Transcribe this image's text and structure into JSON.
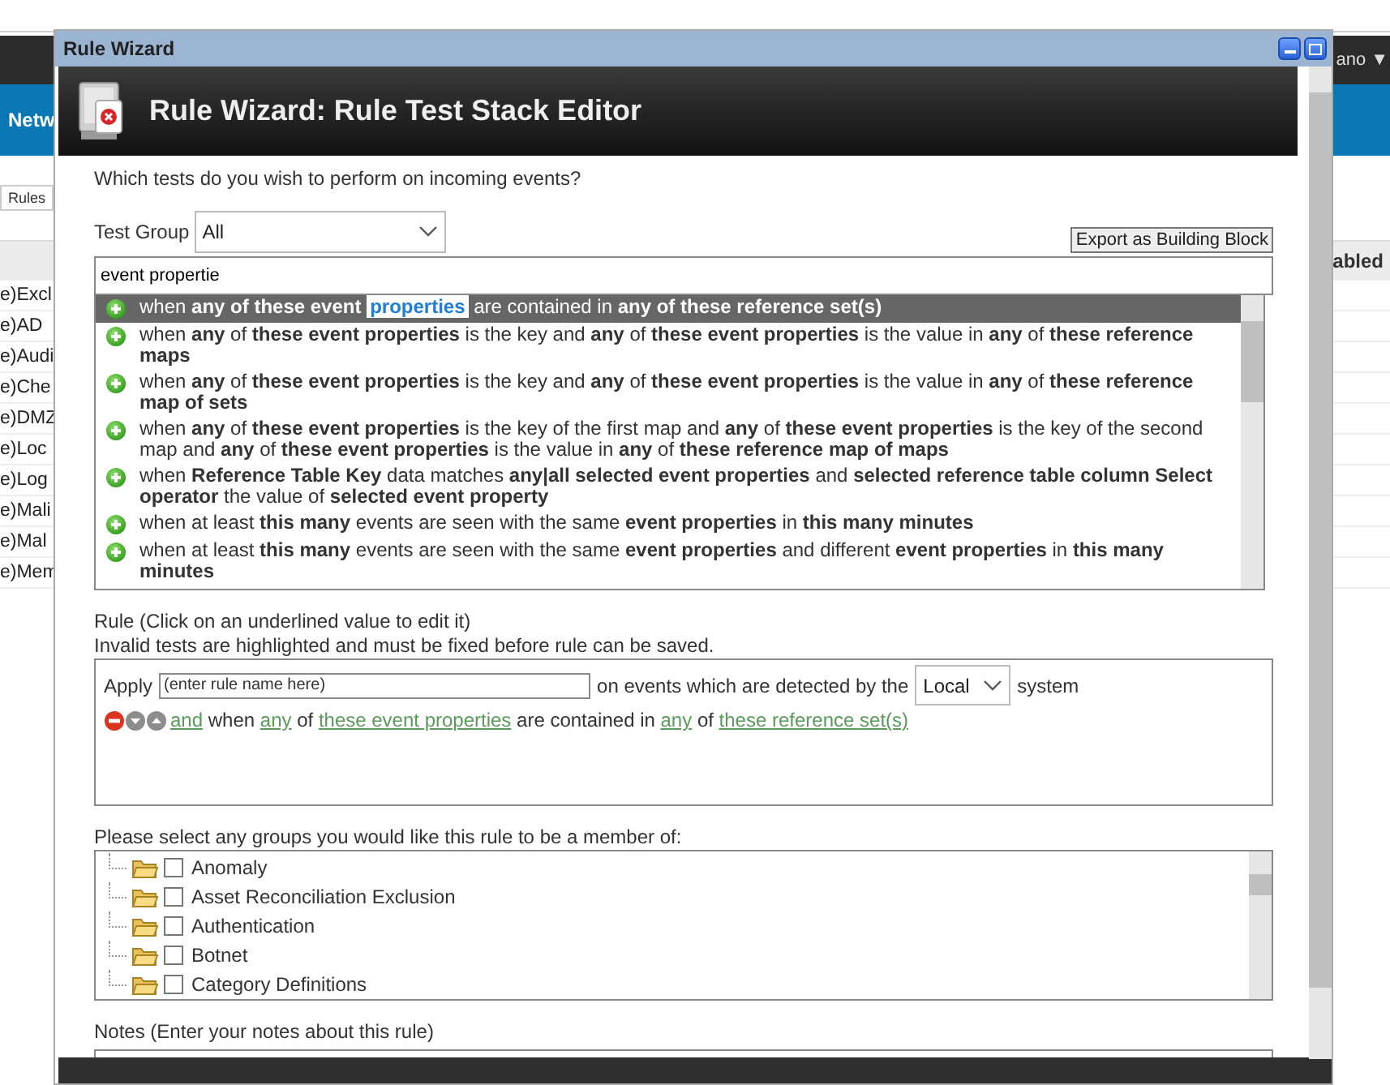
{
  "background": {
    "user_menu": "ano ▼",
    "nav_tab": "Netw",
    "sub_tab": "Rules",
    "column_header": "abled",
    "rows": [
      "e)Excl",
      "e)AD",
      "e)Audi",
      "e)Che",
      "e)DMZ",
      "e)Loc",
      "e)Log",
      "e)Mali",
      "e)Mal",
      "e)Mem"
    ]
  },
  "dialog": {
    "title": "Rule Wizard",
    "heading": "Rule Wizard: Rule Test Stack Editor",
    "prompt": "Which tests do you wish to perform on incoming events?",
    "test_group": {
      "label": "Test Group",
      "value": "All"
    },
    "export_button": "Export as Building Block",
    "search": {
      "value": "event propertie"
    },
    "tests": [
      {
        "selected": true,
        "before": "when **any of these event** ",
        "match": "properties",
        "after": " are contained in **any of these reference set(s)**"
      },
      {
        "selected": false,
        "text": "when **any** of **these event properties** is the key and **any** of **these event properties** is the value in **any** of **these reference maps**"
      },
      {
        "selected": false,
        "text": "when **any** of **these event properties** is the key and **any** of **these event properties** is the value in **any** of **these reference map of sets**"
      },
      {
        "selected": false,
        "text": "when **any** of **these event properties** is the key of the first map and **any** of **these event properties** is the key of the second map and **any** of **these event properties** is the value in **any** of **these reference map of maps**"
      },
      {
        "selected": false,
        "text": "when **Reference Table Key** data matches **any|all selected event properties** and **selected reference table column Select operator** the value of **selected event property**"
      },
      {
        "selected": false,
        "text": "when at least **this many** events are seen with the same **event properties** in **this many minutes**"
      },
      {
        "selected": false,
        "text": "when at least **this many** events are seen with the same **event properties** and different **event properties** in **this many minutes**"
      }
    ],
    "rule": {
      "title": "Rule (Click on an underlined value to edit it)",
      "note": "Invalid tests are highlighted and must be fixed before rule can be saved.",
      "apply_label": "Apply",
      "name_value": "(enter rule name here)",
      "detected_label": "on events which are detected by the",
      "system_value": "Local",
      "system_label": "system",
      "tests": [
        {
          "parts": [
            {
              "text": "and",
              "link": true
            },
            {
              "text": " when ",
              "link": false
            },
            {
              "text": "any",
              "link": true
            },
            {
              "text": " of ",
              "link": false
            },
            {
              "text": "these event properties",
              "link": true
            },
            {
              "text": " are contained in ",
              "link": false
            },
            {
              "text": "any",
              "link": true
            },
            {
              "text": " of ",
              "link": false
            },
            {
              "text": "these reference set(s)",
              "link": true
            }
          ]
        }
      ]
    },
    "groups": {
      "label": "Please select any groups you would like this rule to be a member of:",
      "items": [
        {
          "label": "Anomaly",
          "checked": false
        },
        {
          "label": "Asset Reconciliation Exclusion",
          "checked": false
        },
        {
          "label": "Authentication",
          "checked": false
        },
        {
          "label": "Botnet",
          "checked": false
        },
        {
          "label": "Category Definitions",
          "checked": false
        }
      ]
    },
    "notes": {
      "label": "Notes (Enter your notes about this rule)"
    }
  }
}
